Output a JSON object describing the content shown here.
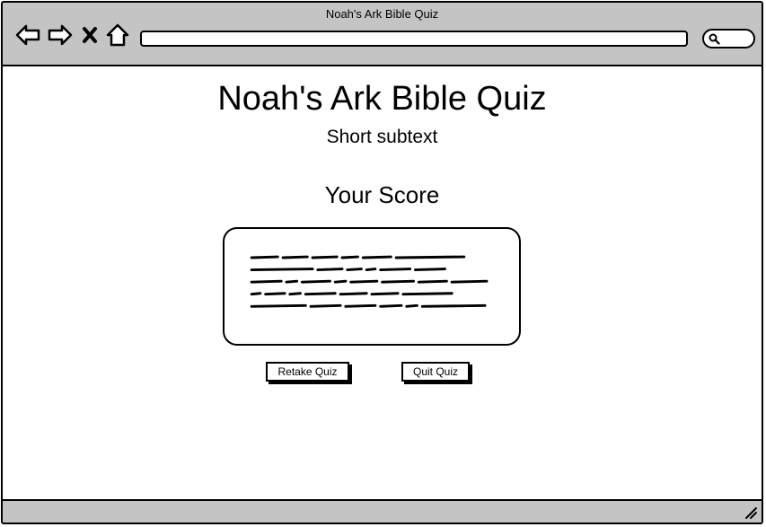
{
  "window": {
    "title": "Noah's Ark Bible Quiz"
  },
  "toolbar": {
    "icons": [
      "back-arrow-icon",
      "forward-arrow-icon",
      "close-x-icon",
      "home-icon",
      "search-icon"
    ]
  },
  "main": {
    "title": "Noah's Ark Bible Quiz",
    "subtitle": "Short subtext",
    "score_heading": "Your Score",
    "buttons": {
      "retake": "Retake Quiz",
      "quit": "Quit Quiz"
    }
  },
  "colors": {
    "chrome": "#c4c4c4",
    "ink": "#000000",
    "page": "#ffffff"
  }
}
